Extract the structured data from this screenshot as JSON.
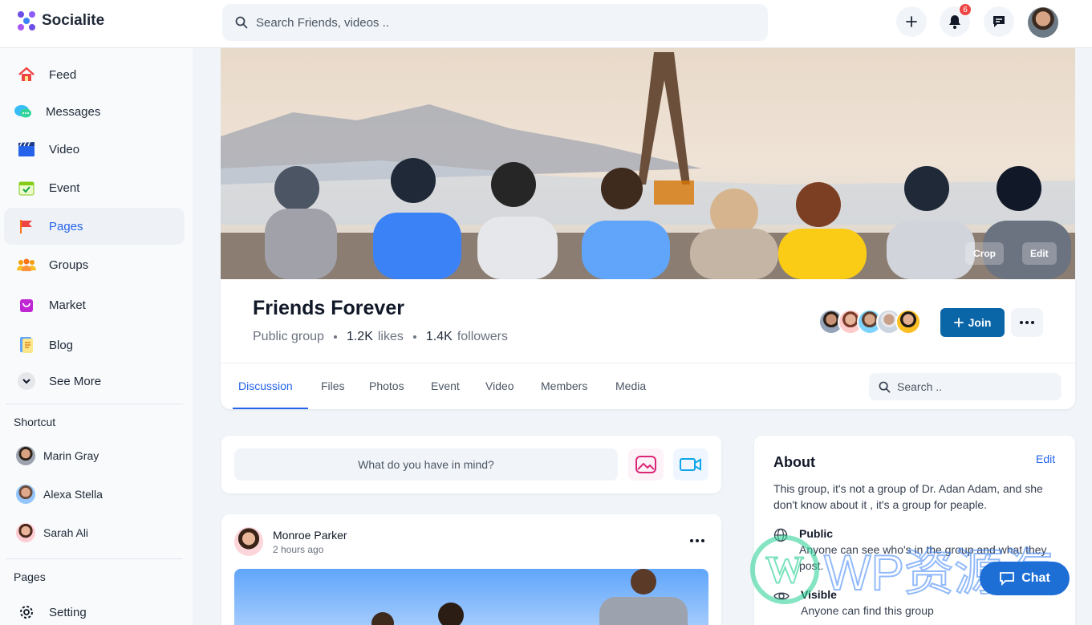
{
  "app": {
    "name": "Socialite"
  },
  "header": {
    "search_placeholder": "Search Friends, videos ..",
    "notification_count": "6"
  },
  "sidebar": {
    "items": [
      {
        "label": "Feed",
        "icon": "home-icon"
      },
      {
        "label": "Messages",
        "icon": "messages-icon"
      },
      {
        "label": "Video",
        "icon": "video-icon"
      },
      {
        "label": "Event",
        "icon": "event-icon"
      },
      {
        "label": "Pages",
        "icon": "flag-icon"
      },
      {
        "label": "Groups",
        "icon": "groups-icon"
      },
      {
        "label": "Market",
        "icon": "market-icon"
      },
      {
        "label": "Blog",
        "icon": "blog-icon"
      },
      {
        "label": "See More",
        "icon": "chevron-down-icon"
      }
    ],
    "shortcut_title": "Shortcut",
    "shortcuts": [
      {
        "name": "Marin Gray"
      },
      {
        "name": "Alexa Stella"
      },
      {
        "name": "Sarah Ali"
      }
    ],
    "pages_title": "Pages",
    "setting_label": "Setting"
  },
  "cover": {
    "crop_label": "Crop",
    "edit_label": "Edit"
  },
  "group": {
    "name": "Friends Forever",
    "type": "Public group",
    "likes_count": "1.2K",
    "likes_label": "likes",
    "followers_count": "1.4K",
    "followers_label": "followers",
    "join_label": "Join"
  },
  "tabs": [
    {
      "label": "Discussion"
    },
    {
      "label": "Files"
    },
    {
      "label": "Photos"
    },
    {
      "label": "Event"
    },
    {
      "label": "Video"
    },
    {
      "label": "Members"
    },
    {
      "label": "Media"
    }
  ],
  "group_search_placeholder": "Search ..",
  "composer": {
    "placeholder": "What do you have in mind?"
  },
  "post": {
    "author": "Monroe Parker",
    "time": "2 hours ago"
  },
  "about": {
    "title": "About",
    "edit_label": "Edit",
    "description": "This group, it's not a group of Dr. Adan Adam, and she don't know about it , it's a group for peaple.",
    "public_title": "Public",
    "public_text": "Anyone can see who's in the group and what they post.",
    "visible_title": "Visible",
    "visible_text": "Anyone can find this group"
  },
  "watermark": {
    "text": "WP资源海"
  },
  "chat_label": "Chat",
  "colors": {
    "accent": "#2563eb",
    "join": "#0b66a8",
    "chat": "#1d6fd6",
    "badge": "#ef4444"
  }
}
